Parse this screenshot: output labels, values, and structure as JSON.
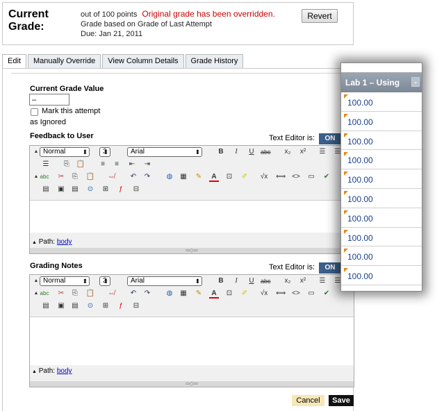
{
  "header": {
    "title_line1": "Current",
    "title_line2": "Grade:",
    "points_text": "out of 100 points",
    "override_text": "Original grade has been overridden.",
    "basis_text": "Grade based on Grade of Last Attempt",
    "due_text": "Due: Jan 21, 2011",
    "revert_label": "Revert"
  },
  "tabs": [
    {
      "label": "Edit",
      "active": true
    },
    {
      "label": "Manually Override",
      "active": false
    },
    {
      "label": "View Column Details",
      "active": false
    },
    {
      "label": "Grade History",
      "active": false
    }
  ],
  "edit": {
    "current_grade_label": "Current Grade Value",
    "grade_value": "–",
    "ignore_label_line1": "Mark this attempt",
    "ignore_label_line2": "as Ignored",
    "ignore_checked": false
  },
  "feedback": {
    "title": "Feedback to User",
    "text_editor_label": "Text Editor is:",
    "toggle": "ON",
    "format": "Normal",
    "size": "3",
    "font": "Arial",
    "path_label": "Path:",
    "path_value": "body"
  },
  "notes": {
    "title": "Grading Notes",
    "text_editor_label": "Text Editor is:",
    "toggle": "ON",
    "format": "Normal",
    "size": "3",
    "font": "Arial",
    "path_label": "Path:",
    "path_value": "body"
  },
  "toolbar_icons": {
    "row1": [
      "bold-icon",
      "italic-icon",
      "underline-icon",
      "strikethrough-icon",
      "subscript-icon",
      "superscript-icon",
      "align-left-icon",
      "align-center-icon"
    ],
    "row2": [
      "align-right-icon",
      "cut-copy-icon",
      "paste-icon",
      "ordered-list-icon",
      "unordered-list-icon",
      "outdent-icon",
      "indent-icon"
    ],
    "row3": [
      "spellcheck-icon",
      "cut-icon",
      "copy-icon",
      "paste-text-icon",
      "unlink-icon",
      "undo-icon",
      "redo-icon",
      "globe-icon",
      "table-icon",
      "pencil-icon",
      "font-color-icon",
      "image-insert-icon",
      "highlight-icon",
      "equation-icon",
      "html-tag-icon",
      "source-code-icon",
      "preview-icon",
      "check-icon"
    ],
    "row4": [
      "file-icon",
      "image-icon",
      "media-icon",
      "link-icon",
      "flash-icon",
      "attachment-icon"
    ]
  },
  "buttons": {
    "cancel": "Cancel",
    "save": "Save"
  },
  "popup": {
    "column_title": "Lab 1 – Using",
    "values": [
      "100.00",
      "100.00",
      "100.00",
      "100.00",
      "100.00",
      "100.00",
      "100.00",
      "100.00",
      "100.00",
      "100.00"
    ]
  }
}
